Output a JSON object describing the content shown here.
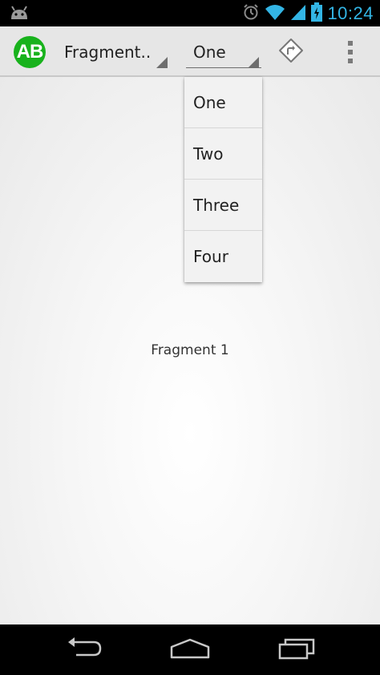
{
  "status_bar": {
    "time": "10:24",
    "icons": [
      "android-icon",
      "alarm-icon",
      "wifi-icon",
      "cell-signal-icon",
      "battery-charging-icon"
    ],
    "accent_color": "#33b5e5"
  },
  "action_bar": {
    "app_icon_text": "AB",
    "app_icon_color": "#18b21c",
    "title_spinner_label": "Fragment..",
    "list_spinner_selected": "One",
    "action_icon": "directions-icon",
    "overflow_icon": "overflow-menu-icon"
  },
  "dropdown": {
    "items": [
      "One",
      "Two",
      "Three",
      "Four"
    ]
  },
  "content": {
    "fragment_text": "Fragment 1"
  },
  "nav_bar": {
    "icons": [
      "back-icon",
      "home-icon",
      "recents-icon"
    ]
  }
}
